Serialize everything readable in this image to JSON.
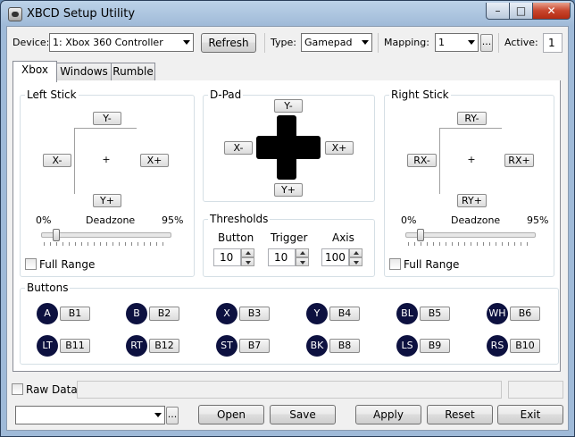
{
  "window": {
    "title": "XBCD Setup Utility",
    "minimize": "–",
    "maximize": "□",
    "close": "✕"
  },
  "toolbar": {
    "device_label": "Device:",
    "device_value": "1: Xbox 360 Controller",
    "refresh": "Refresh",
    "type_label": "Type:",
    "type_value": "Gamepad",
    "mapping_label": "Mapping:",
    "mapping_value": "1",
    "mapping_more": "...",
    "active_label": "Active:",
    "active_value": "1"
  },
  "tabs": [
    "Xbox",
    "Windows",
    "Rumble"
  ],
  "left_stick": {
    "title": "Left Stick",
    "up": "Y-",
    "down": "Y+",
    "left": "X-",
    "right": "X+",
    "center": "+",
    "dz_min": "0%",
    "dz_label": "Deadzone",
    "dz_max": "95%",
    "deadzone": 0.1,
    "full_range": "Full Range"
  },
  "dpad": {
    "title": "D-Pad",
    "up": "Y-",
    "down": "Y+",
    "left": "X-",
    "right": "X+"
  },
  "right_stick": {
    "title": "Right Stick",
    "up": "RY-",
    "down": "RY+",
    "left": "RX-",
    "right": "RX+",
    "center": "+",
    "dz_min": "0%",
    "dz_label": "Deadzone",
    "dz_max": "95%",
    "deadzone": 0.1,
    "full_range": "Full Range"
  },
  "thresholds": {
    "title": "Thresholds",
    "button_label": "Button",
    "button_value": "10",
    "trigger_label": "Trigger",
    "trigger_value": "10",
    "axis_label": "Axis",
    "axis_value": "100"
  },
  "buttons": {
    "title": "Buttons",
    "row1": [
      {
        "pad": "A",
        "map": "B1"
      },
      {
        "pad": "B",
        "map": "B2"
      },
      {
        "pad": "X",
        "map": "B3"
      },
      {
        "pad": "Y",
        "map": "B4"
      },
      {
        "pad": "BL",
        "map": "B5"
      },
      {
        "pad": "WH",
        "map": "B6"
      }
    ],
    "row2": [
      {
        "pad": "LT",
        "map": "B11"
      },
      {
        "pad": "RT",
        "map": "B12"
      },
      {
        "pad": "ST",
        "map": "B7"
      },
      {
        "pad": "BK",
        "map": "B8"
      },
      {
        "pad": "LS",
        "map": "B9"
      },
      {
        "pad": "RS",
        "map": "B10"
      }
    ]
  },
  "status": {
    "raw_data": "Raw Data"
  },
  "footer": {
    "file_value": "",
    "browse": "...",
    "open": "Open",
    "save": "Save",
    "apply": "Apply",
    "reset": "Reset",
    "exit": "Exit"
  },
  "colors": {
    "pad_button": "#0d1140",
    "title_bar": "#9fbad8",
    "close_button": "#c8452c"
  }
}
